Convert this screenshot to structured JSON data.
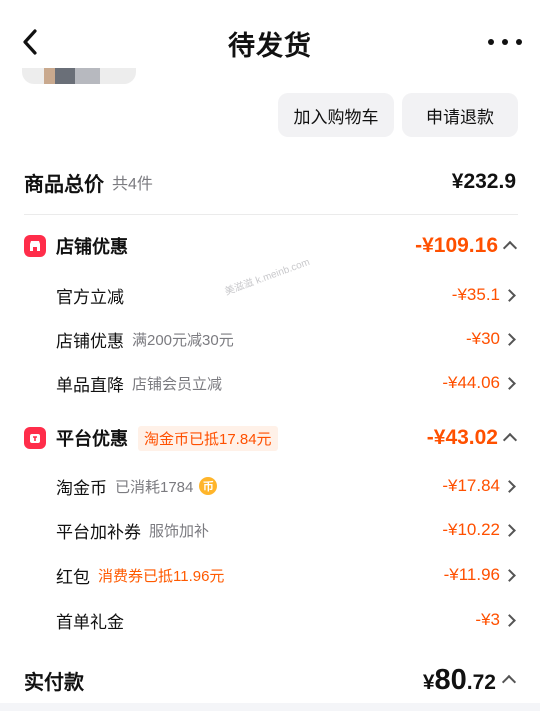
{
  "header": {
    "title": "待发货"
  },
  "actions": {
    "add_to_cart": "加入购物车",
    "refund": "申请退款"
  },
  "total": {
    "label": "商品总价",
    "count": "共4件",
    "value": "¥232.9"
  },
  "shop_discount": {
    "icon": "shop-icon",
    "title": "店铺优惠",
    "value": "-¥109.16",
    "items": [
      {
        "label": "官方立减",
        "sub": "",
        "value": "-¥35.1"
      },
      {
        "label": "店铺优惠",
        "sub": "满200元减30元",
        "value": "-¥30"
      },
      {
        "label": "单品直降",
        "sub": "店铺会员立减",
        "value": "-¥44.06"
      }
    ]
  },
  "platform_discount": {
    "icon": "platform-icon",
    "title": "平台优惠",
    "tag": "淘金币已抵17.84元",
    "value": "-¥43.02",
    "items": [
      {
        "label": "淘金币",
        "sub": "已消耗1784",
        "coin_icon": "币",
        "value": "-¥17.84"
      },
      {
        "label": "平台加补券",
        "sub": "服饰加补",
        "value": "-¥10.22"
      },
      {
        "label": "红包",
        "sub": "消费券已抵11.96元",
        "value": "-¥11.96"
      },
      {
        "label": "首单礼金",
        "sub": "",
        "value": "-¥3"
      }
    ]
  },
  "payment": {
    "label": "实付款",
    "currency": "¥",
    "integer": "80",
    "decimal": ".72"
  },
  "watermark": "美滋滋 k.meinb.com",
  "colors": {
    "accent": "#ff5000",
    "shop_icon": "#ff2d4a",
    "tag_bg": "#fff1e8"
  }
}
